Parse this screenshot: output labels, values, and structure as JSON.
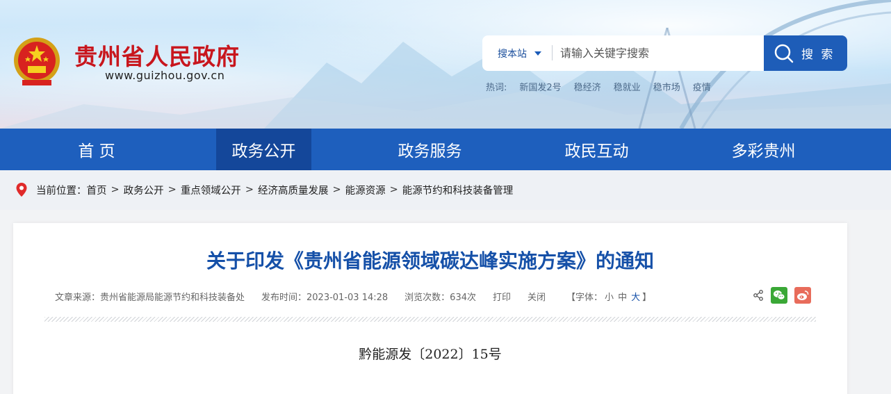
{
  "header": {
    "site_title": "贵州省人民政府",
    "site_url": "www.guizhou.gov.cn",
    "emblem_icon": "national-emblem-icon"
  },
  "search": {
    "scope_label": "搜本站",
    "placeholder": "请输入关键字搜索",
    "button_label": "搜 索",
    "hot_label": "热词:",
    "hot_words": [
      "新国发2号",
      "稳经济",
      "稳就业",
      "稳市场",
      "疫情"
    ]
  },
  "nav": {
    "items": [
      "首 页",
      "政务公开",
      "政务服务",
      "政民互动",
      "多彩贵州"
    ],
    "active_index": 1
  },
  "breadcrumb": {
    "prefix": "当前位置：",
    "items": [
      "首页",
      "政务公开",
      "重点领域公开",
      "经济高质量发展",
      "能源资源",
      "能源节约和科技装备管理"
    ],
    "separator": ">"
  },
  "article": {
    "title": "关于印发《贵州省能源领域碳达峰实施方案》的通知",
    "source": "文章来源：贵州省能源局能源节约和科技装备处",
    "publish_time": "发布时间：2023-01-03 14:28",
    "views": "浏览次数：634次",
    "print_label": "打印",
    "close_label": "关闭",
    "font_size_label": "【字体：",
    "font_small": "小",
    "font_medium": "中",
    "font_large": "大",
    "font_close": "】",
    "doc_number": "黔能源发〔2022〕15号"
  },
  "colors": {
    "nav_bg": "#1e5fbd",
    "nav_active": "#14479a",
    "title_red": "#c8161d",
    "article_title": "#1550a8"
  }
}
